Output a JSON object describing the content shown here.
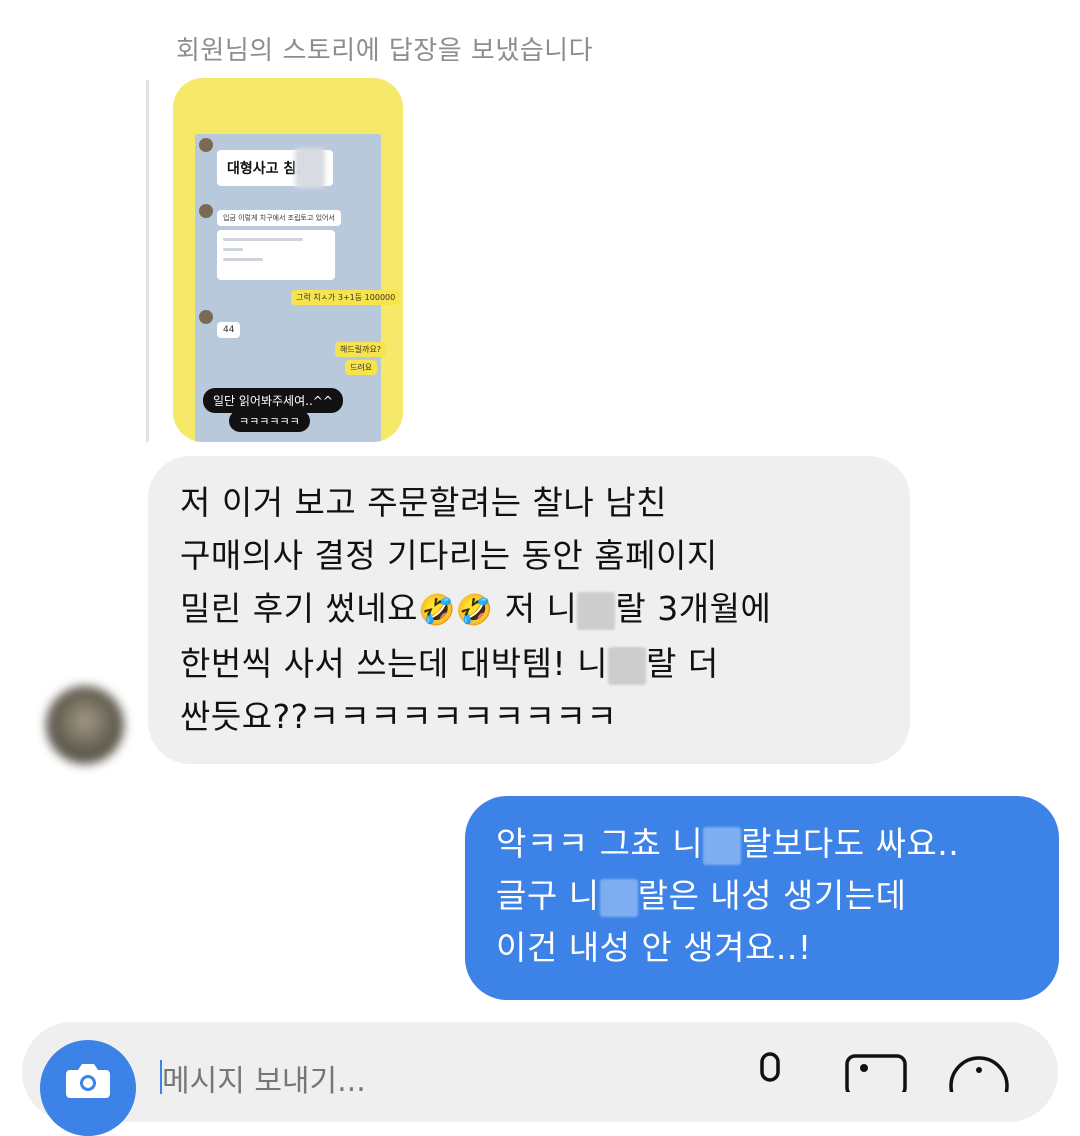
{
  "thread": {
    "story_reply_caption": "회원님의 스토리에 답장을 보냈습니다",
    "story_preview": {
      "headline": "대형사고 침.....",
      "line_order": "입금 이렇게 치구에서 조립토고 있어서",
      "yellow_order": "그럭 치ㅅ가 3+1등 100000",
      "avatar_note": "44",
      "question": "해드릴까요?",
      "answer": "드려요",
      "caption_read": "일단 읽어봐주세여..^^",
      "caption_laugh": "ㅋㅋㅋㅋㅋㅋ"
    },
    "incoming": {
      "line1": "저 이거 보고 주문할려는 찰나 남친",
      "line2": "구매의사 결정 기다리는 동안 홈페이지",
      "line3a": "밀린 후기 썼네요",
      "line3_emoji": "🤣🤣",
      "line3b": " 저 니",
      "line3c": "랄 3개월에",
      "line4a": "한번씩 사서 쓰는데 대박템! 니",
      "line4b": "랄 더",
      "line5": "싼듯요??ㅋㅋㅋㅋㅋㅋㅋㅋㅋㅋ"
    },
    "outgoing": {
      "line1a": "악ㅋㅋ 그쵸 니",
      "line1b": "랄보다도 싸요..",
      "line2a": "글구 니",
      "line2b": "랄은 내성 생기는데",
      "line3": "이건 내성 안 생겨요..!"
    }
  },
  "composer": {
    "placeholder": "메시지 보내기...",
    "icons": [
      "camera-icon",
      "microphone-icon",
      "image-icon",
      "sticker-icon"
    ]
  },
  "colors": {
    "outgoing_bubble": "#3d82e6",
    "incoming_bubble": "#efefef",
    "story_frame": "#f6e96a"
  }
}
